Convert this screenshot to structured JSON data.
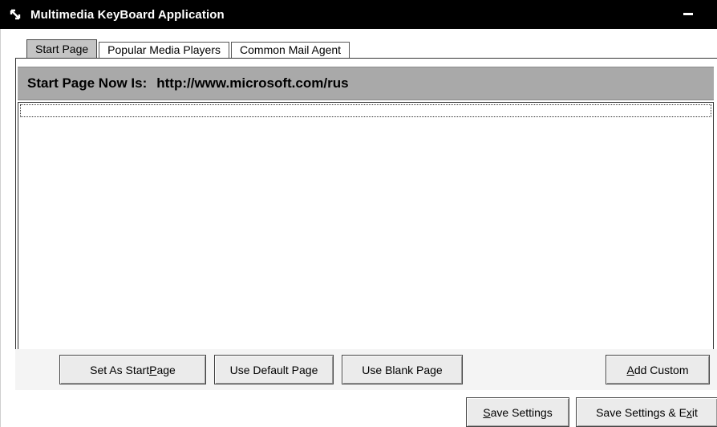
{
  "window": {
    "title": "Multimedia KeyBoard Application",
    "app_icon": "app-arrow-icon",
    "minimize_icon": "minimize-icon"
  },
  "tabs": [
    {
      "label": "Start Page",
      "active": true
    },
    {
      "label": "Popular Media Players",
      "active": false
    },
    {
      "label": "Common Mail Agent",
      "active": false
    }
  ],
  "start_page": {
    "header_label": "Start Page Now Is:",
    "header_value": "http://www.microsoft.com/rus",
    "list_items": [
      ""
    ]
  },
  "buttons": {
    "set_start_pre": "Set As Start ",
    "set_start_u": "P",
    "set_start_post": "age",
    "use_default": "Use Default Page",
    "use_blank": "Use Blank Page",
    "add_custom_u": "A",
    "add_custom_post": "dd Custom",
    "save_u": "S",
    "save_post": "ave Settings",
    "save_exit_pre": "Save Settings & E",
    "save_exit_u": "x",
    "save_exit_post": "it"
  },
  "colors": {
    "titlebar_bg": "#000000",
    "header_bg": "#a9a9a9",
    "active_tab_bg": "#c4c4c4",
    "button_bg": "#ebebeb"
  }
}
